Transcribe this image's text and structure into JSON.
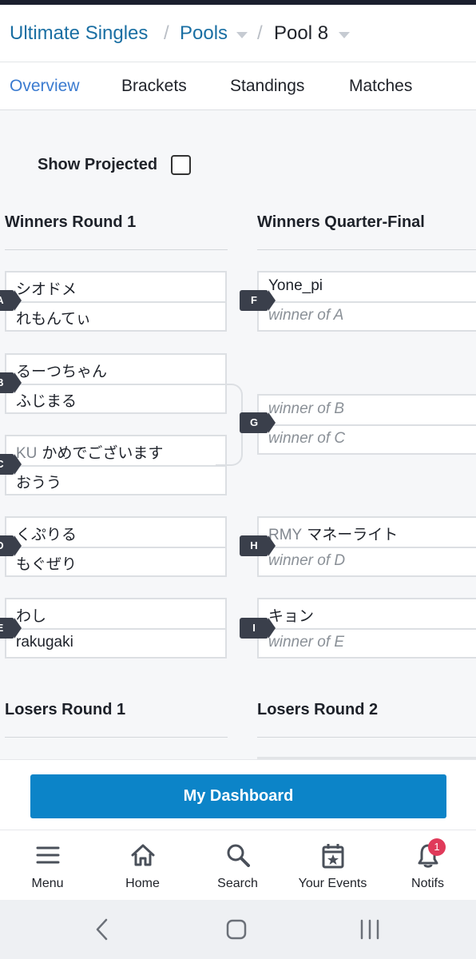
{
  "breadcrumb": {
    "items": [
      {
        "label": "Ultimate Singles"
      },
      {
        "label": "Pools"
      },
      {
        "label": "Pool 8"
      }
    ],
    "separator": "/"
  },
  "tabs": [
    {
      "label": "Overview",
      "active": true
    },
    {
      "label": "Brackets"
    },
    {
      "label": "Standings"
    },
    {
      "label": "Matches"
    }
  ],
  "show_projected": {
    "label": "Show Projected",
    "checked": false
  },
  "rounds": {
    "winners_round_1": {
      "title": "Winners Round 1"
    },
    "winners_qf": {
      "title": "Winners Quarter-Final"
    },
    "losers_round_1": {
      "title": "Losers Round 1"
    },
    "losers_round_2": {
      "title": "Losers Round 2"
    }
  },
  "matches": {
    "A": {
      "id": "A",
      "p1": {
        "prefix": "",
        "name": "シオドメ"
      },
      "p2": {
        "prefix": "",
        "name": "れもんてぃ"
      }
    },
    "B": {
      "id": "B",
      "p1": {
        "prefix": "",
        "name": "るーつちゃん"
      },
      "p2": {
        "prefix": "",
        "name": "ふじまる"
      }
    },
    "C": {
      "id": "C",
      "p1": {
        "prefix": "KU",
        "name": "かめでございます"
      },
      "p2": {
        "prefix": "",
        "name": "おうう"
      }
    },
    "D": {
      "id": "D",
      "p1": {
        "prefix": "",
        "name": "くぷりる"
      },
      "p2": {
        "prefix": "",
        "name": "もぐぜり"
      }
    },
    "E": {
      "id": "E",
      "p1": {
        "prefix": "",
        "name": "わし"
      },
      "p2": {
        "prefix": "",
        "name": "rakugaki"
      }
    },
    "F": {
      "id": "F",
      "p1": {
        "prefix": "",
        "name": "Yone_pi"
      },
      "p2": {
        "name": "winner of A"
      }
    },
    "G": {
      "id": "G",
      "p1": {
        "name": "winner of B"
      },
      "p2": {
        "name": "winner of C"
      }
    },
    "H": {
      "id": "H",
      "p1": {
        "prefix": "RMY",
        "name": "マネーライト"
      },
      "p2": {
        "name": "winner of D"
      }
    },
    "I": {
      "id": "I",
      "p1": {
        "prefix": "",
        "name": "キョン"
      },
      "p2": {
        "name": "winner of E"
      }
    }
  },
  "dashboard": {
    "label": "My Dashboard",
    "color": "#0c84c8"
  },
  "bottom_nav": [
    {
      "label": "Menu",
      "icon": "menu-icon"
    },
    {
      "label": "Home",
      "icon": "home-icon"
    },
    {
      "label": "Search",
      "icon": "search-icon"
    },
    {
      "label": "Your Events",
      "icon": "calendar-star-icon"
    },
    {
      "label": "Notifs",
      "icon": "bell-icon",
      "badge": "1"
    }
  ],
  "colors": {
    "link": "#1a6fa3",
    "active_tab": "#3b7bd0",
    "badge": "#3a3f4b",
    "notif": "#e03a5a"
  }
}
